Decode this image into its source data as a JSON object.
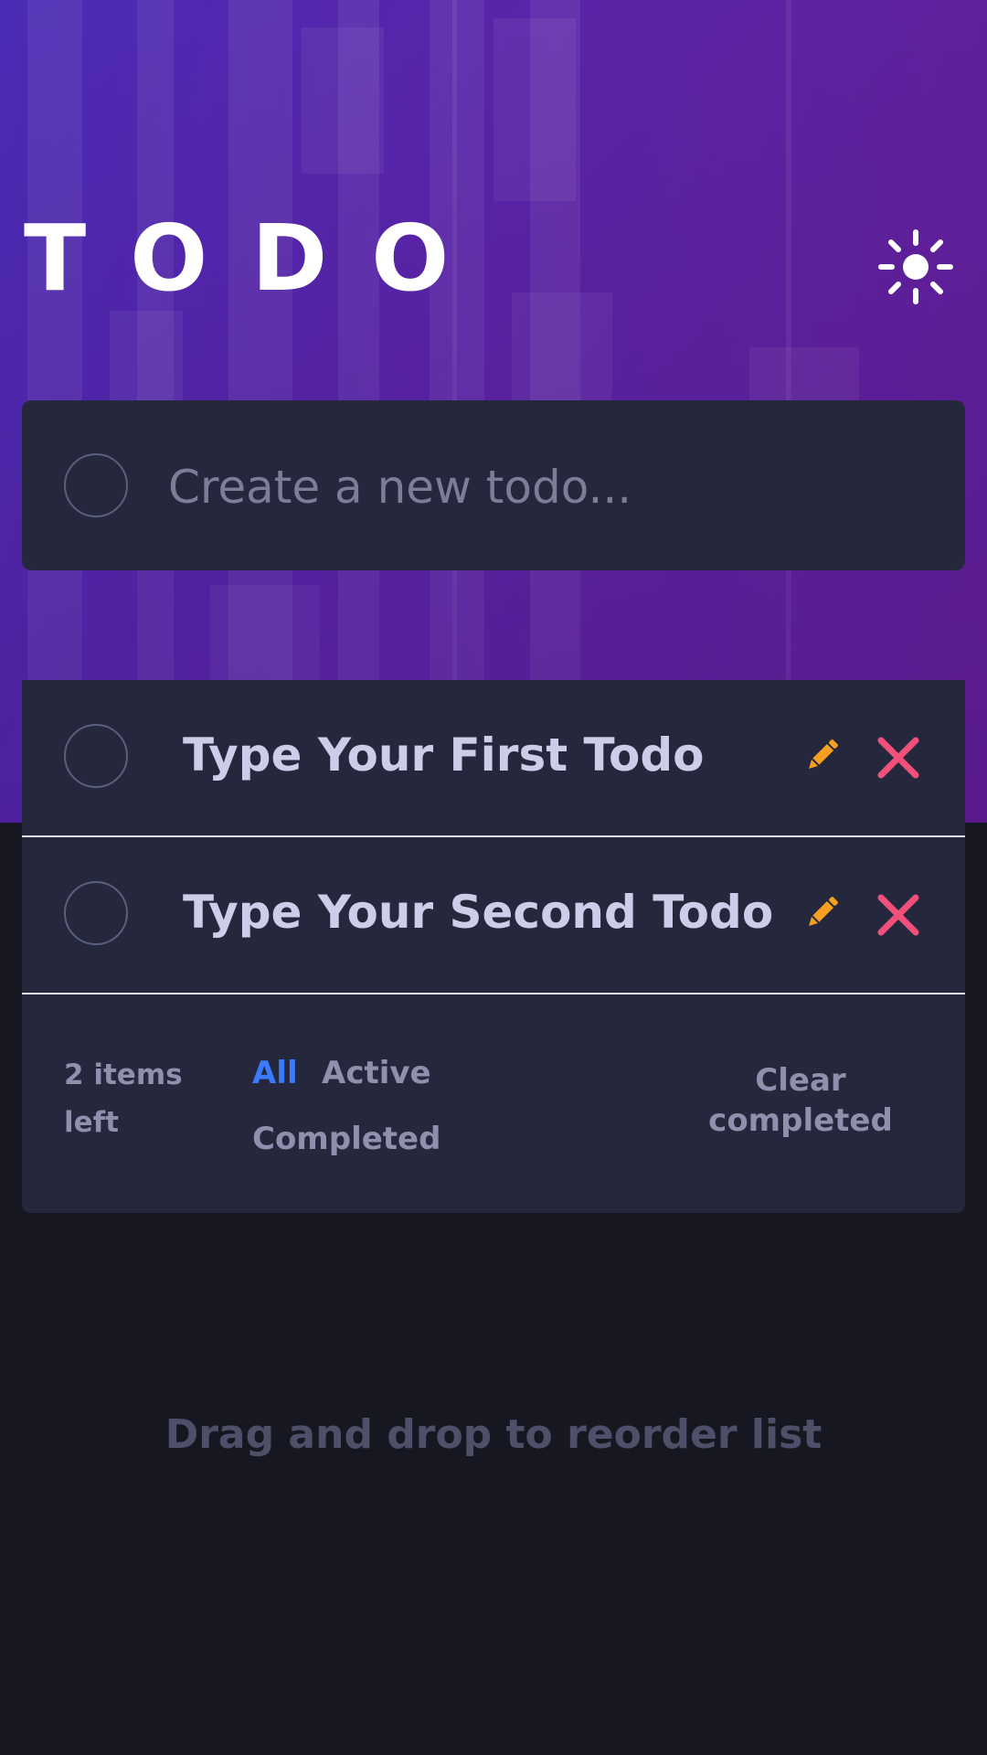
{
  "header": {
    "title": "TODO",
    "theme_toggle_icon": "sun-icon"
  },
  "new_todo": {
    "placeholder": "Create a new todo..."
  },
  "todos": [
    {
      "text": "Type Your First Todo",
      "completed": false
    },
    {
      "text": "Type Your Second Todo",
      "completed": false
    }
  ],
  "footer": {
    "items_left": "2 items left",
    "filters": [
      "All",
      "Active",
      "Completed"
    ],
    "active_filter": "All",
    "clear_label": "Clear completed"
  },
  "hint": "Drag and drop to reorder list",
  "colors": {
    "accent": "#3a7bfd",
    "edit_icon": "#f5a020",
    "delete_icon": "#f0507a",
    "card": "#25273c",
    "background": "#171722"
  }
}
